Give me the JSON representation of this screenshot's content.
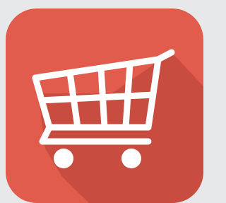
{
  "app_icon": {
    "icon": "shopping-cart-icon",
    "colors": {
      "page_background": "#e7e8ea",
      "tile": "#e25c4e",
      "long_shadow": "#c4493f",
      "glyph": "#ffffff"
    }
  }
}
